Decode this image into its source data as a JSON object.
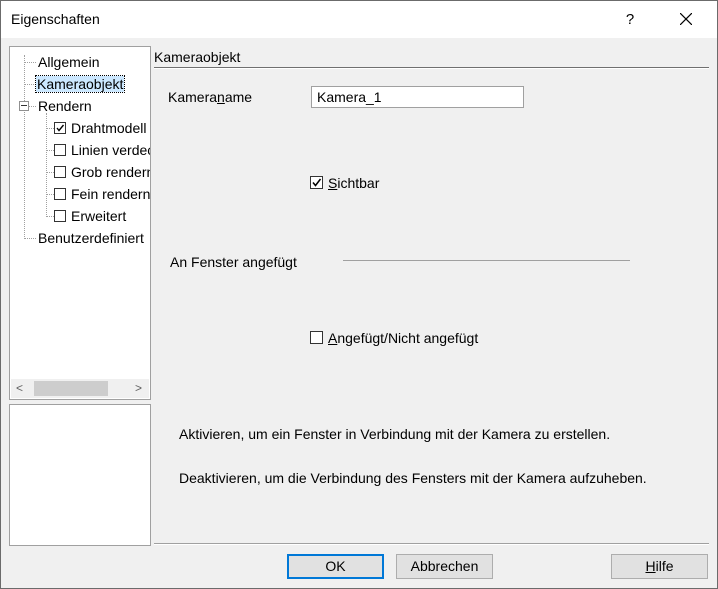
{
  "window": {
    "title": "Eigenschaften",
    "help_glyph": "?"
  },
  "tree": {
    "items": [
      {
        "label": "Allgemein"
      },
      {
        "label": "Kameraobjekt",
        "selected": true
      },
      {
        "label": "Rendern",
        "expanded": true
      },
      {
        "label": "Drahtmodell",
        "checked": true
      },
      {
        "label": "Linien verdeckt",
        "checked": false
      },
      {
        "label": "Grob rendern",
        "checked": false
      },
      {
        "label": "Fein rendern",
        "checked": false
      },
      {
        "label": "Erweitert",
        "checked": false
      },
      {
        "label": "Benutzerdefiniert"
      }
    ],
    "scroll_left": "<",
    "scroll_right": ">"
  },
  "section": {
    "title": "Kameraobjekt"
  },
  "camera_name": {
    "label_pre": "Kamera",
    "label_ul": "n",
    "label_post": "ame",
    "value": "Kamera_1"
  },
  "visible": {
    "label_ul": "S",
    "label_rest": "ichtbar",
    "checked": true
  },
  "attached_group": {
    "label": "An Fenster angefügt"
  },
  "attached": {
    "label_ul": "A",
    "label_rest": "ngefügt/Nicht angefügt",
    "checked": false
  },
  "help_text": {
    "line1": "Aktivieren, um ein Fenster in Verbindung mit der Kamera zu erstellen.",
    "line2": "Deaktivieren, um die Verbindung des Fensters mit der Kamera aufzuheben."
  },
  "buttons": {
    "ok": "OK",
    "cancel": "Abbrechen",
    "help_ul": "H",
    "help_rest": "ilfe"
  },
  "colors": {
    "selection": "#cce8ff",
    "default_button_border": "#0078d7"
  }
}
